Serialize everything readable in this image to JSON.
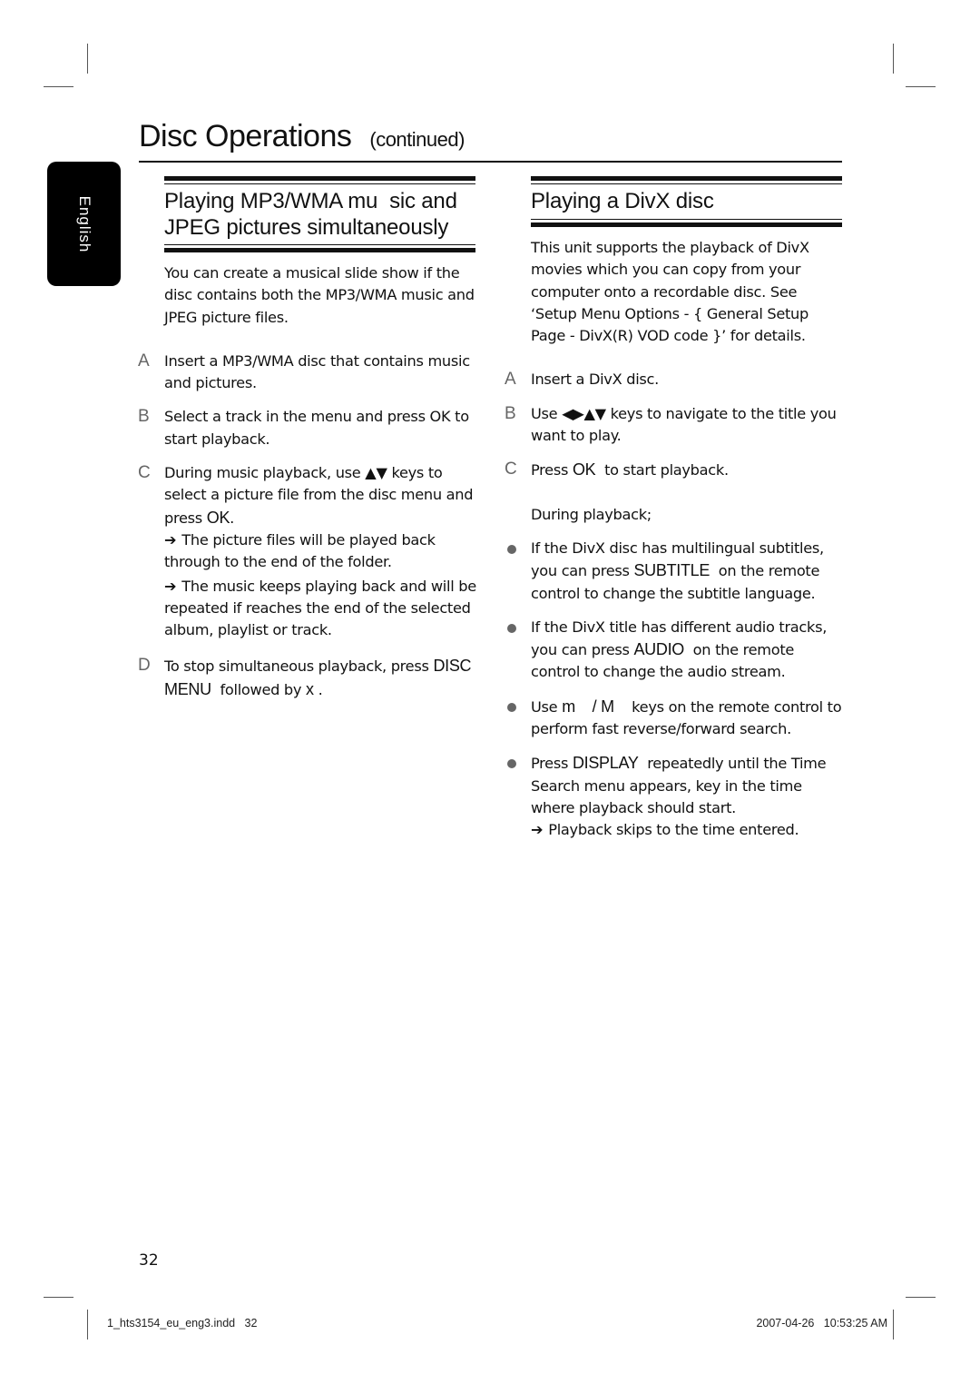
{
  "header": {
    "title": "Disc Operations",
    "continued": "(continued)"
  },
  "language_tab": "English",
  "left_section": {
    "title_line1": "Playing MP3/WMA mu  sic and",
    "title_line2": "JPEG pictures simultaneously",
    "intro": "You can create a musical slide show if the disc contains both the MP3/WMA music and JPEG picture files.",
    "steps": [
      {
        "letter": "A",
        "text": "Insert a MP3/WMA disc that contains music and pictures."
      },
      {
        "letter": "B",
        "text": "Select a track in the menu and press OK to start playback."
      },
      {
        "letter": "C",
        "text_before": "During music playback, use ",
        "keys": "▲▼",
        "text_after": " keys to select a picture file from the disc menu and press ",
        "key_ok": "OK",
        "text_end": ".",
        "results": [
          "The picture files will be played back through to the end of the folder.",
          "The music keeps playing back and will be repeated if reaches the end of the selected album, playlist or track."
        ]
      },
      {
        "letter": "D",
        "text_before": "To stop simultaneous playback, press ",
        "key1": "DISC MENU",
        "text_mid": "  followed by ",
        "key2": "x",
        "text_end": " ."
      }
    ]
  },
  "right_section": {
    "title": "Playing a DivX disc",
    "intro": "This unit supports the playback of DivX movies which you can copy from your computer onto a recordable disc. See ‘Setup Menu Options - { General Setup Page - DivX(R) VOD code }’ for details.",
    "steps": [
      {
        "letter": "A",
        "text": "Insert a DivX disc."
      },
      {
        "letter": "B",
        "text_before": "Use ",
        "keys": "◀▶▲▼",
        "text_after": " keys to navigate to the title you want to play."
      },
      {
        "letter": "C",
        "text_before": "Press ",
        "key": "OK",
        "text_after": "  to start playback."
      }
    ],
    "during_label": "During playback;",
    "bullets": [
      {
        "text_before": "If the DivX disc has multilingual subtitles, you can press ",
        "key": "SUBTITLE",
        "text_after": "  on the remote control to change the subtitle language."
      },
      {
        "text_before": "If the DivX title has different audio tracks, you can press ",
        "key": "AUDIO",
        "text_after": "  on the remote control to change the audio stream."
      },
      {
        "text_before": "Use ",
        "key": "m    / M",
        "text_after": "    keys on the remote control to perform fast reverse/forward search."
      },
      {
        "text_before": "Press ",
        "key": "DISPLAY",
        "text_after": "  repeatedly until the Time Search menu appears, key in the time where playback should start.",
        "result": "Playback skips to the time entered."
      }
    ]
  },
  "arrow_glyph": "➔",
  "page_number": "32",
  "footer": {
    "file": "1_hts3154_eu_eng3.indd   32",
    "date": "2007-04-26   10:53:25 AM"
  }
}
